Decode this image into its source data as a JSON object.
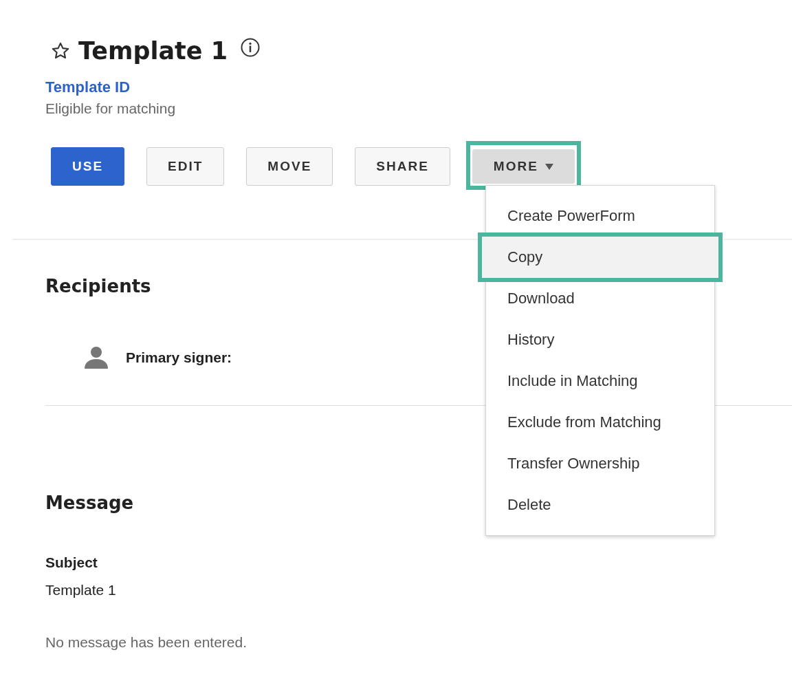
{
  "header": {
    "title": "Template 1",
    "starred": false,
    "id_link": "Template ID",
    "status": "Eligible for matching"
  },
  "actions": [
    {
      "label": "USE",
      "kind": "primary",
      "highlighted": false
    },
    {
      "label": "EDIT",
      "kind": "secondary",
      "highlighted": false
    },
    {
      "label": "MOVE",
      "kind": "secondary",
      "highlighted": false
    },
    {
      "label": "SHARE",
      "kind": "secondary",
      "highlighted": false
    },
    {
      "label": "MORE",
      "kind": "dropdown",
      "highlighted": true
    }
  ],
  "menu": {
    "items": [
      {
        "label": "Create PowerForm",
        "highlighted": false
      },
      {
        "label": "Copy",
        "highlighted": true
      },
      {
        "label": "Download",
        "highlighted": false
      },
      {
        "label": "History",
        "highlighted": false
      },
      {
        "label": "Include in Matching",
        "highlighted": false
      },
      {
        "label": "Exclude from Matching",
        "highlighted": false
      },
      {
        "label": "Transfer Ownership",
        "highlighted": false
      },
      {
        "label": "Delete",
        "highlighted": false
      }
    ]
  },
  "recipients": {
    "heading": "Recipients",
    "items": [
      {
        "role": "Primary signer:"
      }
    ]
  },
  "message": {
    "heading": "Message",
    "subject_label": "Subject",
    "subject": "Template 1",
    "body": "No message has been entered."
  }
}
